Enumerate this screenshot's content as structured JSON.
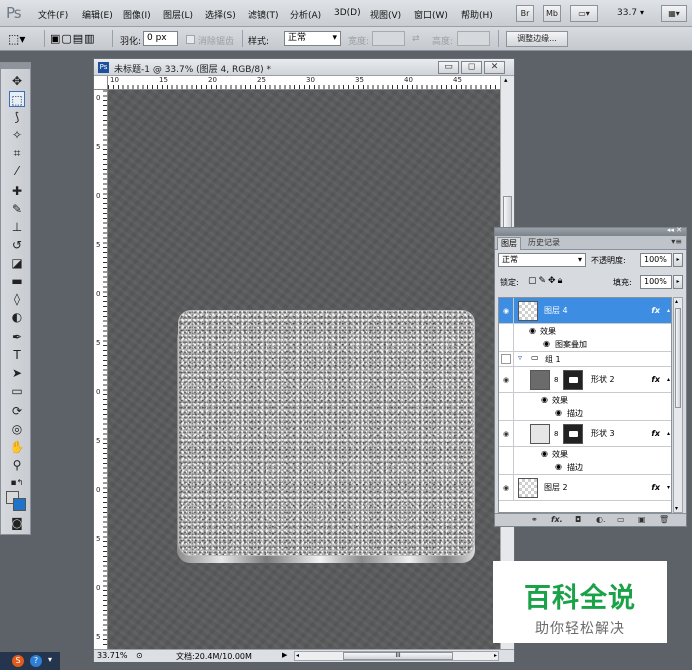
{
  "app": {
    "logo": "Ps"
  },
  "menu": {
    "items": [
      "文件(F)",
      "编辑(E)",
      "图像(I)",
      "图层(L)",
      "选择(S)",
      "滤镜(T)",
      "分析(A)",
      "3D(D)",
      "视图(V)",
      "窗口(W)",
      "帮助(H)"
    ],
    "buttons": {
      "bridge": "Br",
      "mini_bridge": "Mb"
    },
    "zoom": "33.7"
  },
  "options": {
    "feather_label": "羽化:",
    "feather_value": "0 px",
    "antialias_label": "消除锯齿",
    "style_label": "样式:",
    "style_value": "正常",
    "width_label": "宽度:",
    "height_label": "高度:",
    "refine_edge": "调整边缘..."
  },
  "document": {
    "title": "未标题-1 @ 33.7% (图层 4, RGB/8) *",
    "ruler_top": [
      "10",
      "15",
      "20",
      "25",
      "30",
      "35",
      "40",
      "45"
    ],
    "ruler_left": [
      "0",
      "5",
      "0",
      "5",
      "0",
      "5",
      "0",
      "5",
      "0",
      "5",
      "0",
      "5"
    ],
    "status_zoom": "33.71%",
    "status_doc": "文档:20.4M/10.00M",
    "hscroll_label": "III"
  },
  "layers_panel": {
    "tabs": [
      "图层",
      "历史记录"
    ],
    "blend_mode": "正常",
    "opacity_label": "不透明度:",
    "opacity_value": "100%",
    "lock_label": "锁定:",
    "fill_label": "填充:",
    "fill_value": "100%",
    "layers": [
      {
        "name": "图层 4",
        "fx": "fx",
        "selected": true
      },
      {
        "effects_label": "效果",
        "effect": "图案叠加"
      },
      {
        "name": "组 1",
        "group": true
      },
      {
        "name": "形状 2",
        "fx": "fx"
      },
      {
        "effects_label": "效果",
        "effect": "描边"
      },
      {
        "name": "形状 3",
        "fx": "fx"
      },
      {
        "effects_label": "效果",
        "effect": "描边"
      },
      {
        "name": "图层 2",
        "fx": "fx"
      }
    ]
  },
  "watermark": {
    "title": "百科全说",
    "subtitle": "助你轻松解决"
  }
}
